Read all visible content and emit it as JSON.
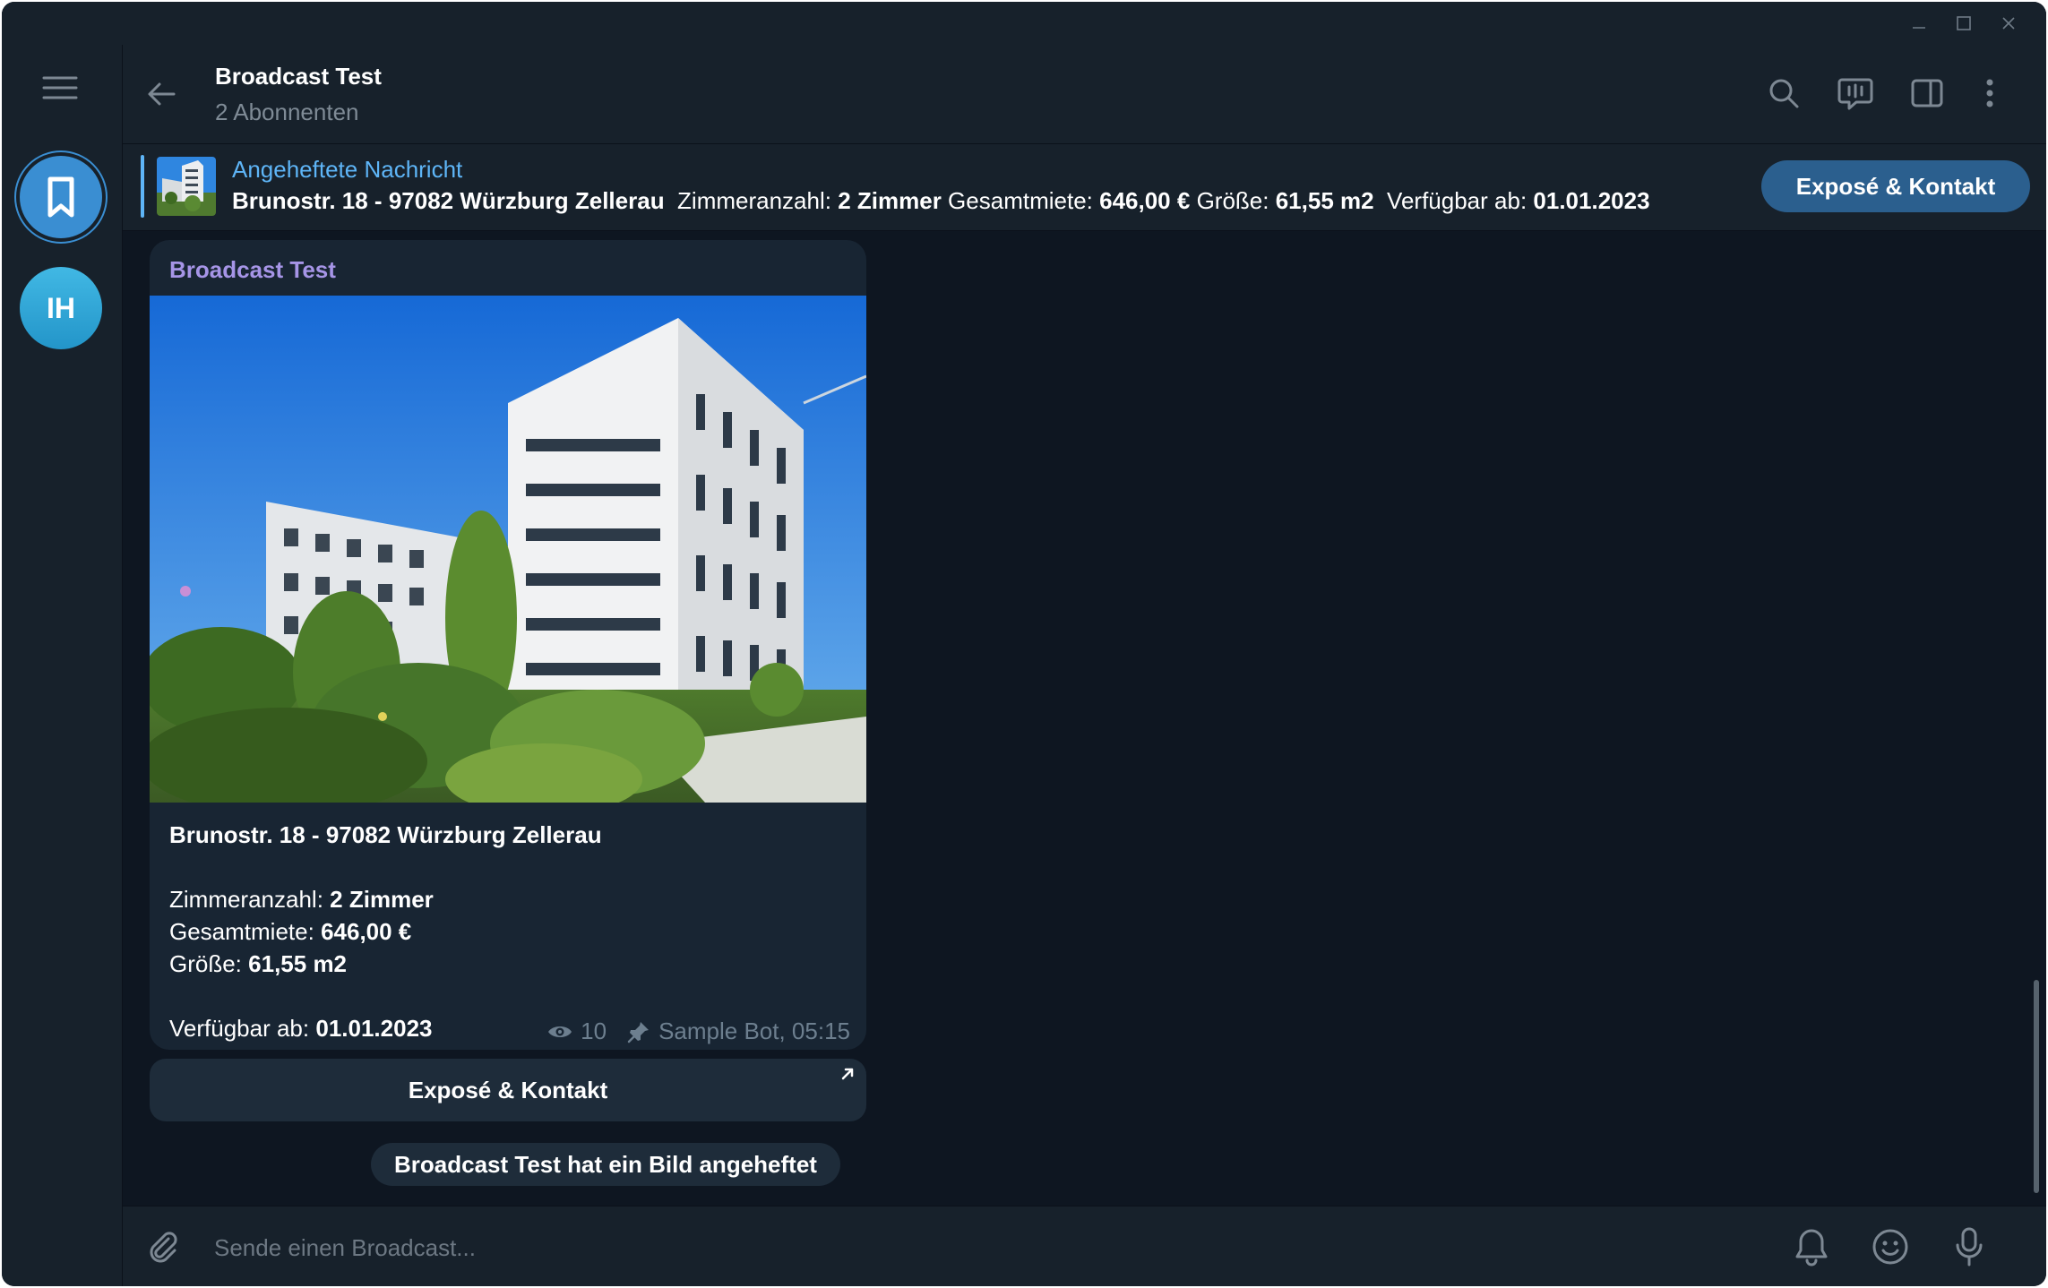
{
  "window": {
    "controls": {
      "minimize": "minimize-icon",
      "maximize": "maximize-icon",
      "close": "close-icon"
    }
  },
  "rail": {
    "menu_icon": "hamburger-menu-icon",
    "saved_icon": "bookmark-icon",
    "saved_color": "#3a8ed2",
    "user_initials": "IH",
    "user_color": "#2aa4d5"
  },
  "header": {
    "back_icon": "back-arrow-icon",
    "title": "Broadcast Test",
    "subtitle": "2 Abonnenten",
    "icons": [
      "search-icon",
      "live-stream-icon",
      "sidebar-toggle-icon",
      "more-vertical-icon"
    ]
  },
  "pinned": {
    "title": "Angeheftete Nachricht",
    "address": "Brunostr. 18 - 97082 Würzburg Zellerau",
    "rooms_label": "Zimmeranzahl:",
    "rooms_value": "2 Zimmer",
    "rent_label": "Gesamtmiete:",
    "rent_value": "646,00 €",
    "size_label": "Größe:",
    "size_value": "61,55 m2",
    "available_label": "Verfügbar ab:",
    "available_value": "01.01.2023",
    "button_label": "Exposé & Kontakt",
    "accent_color": "#5eb5f7"
  },
  "message": {
    "sender": "Broadcast Test",
    "sender_color": "#a695e7",
    "address": "Brunostr. 18 - 97082 Würzburg Zellerau",
    "rooms_label": "Zimmeranzahl:",
    "rooms_value": "2 Zimmer",
    "rent_label": "Gesamtmiete:",
    "rent_value": "646,00 €",
    "size_label": "Größe:",
    "size_value": "61,55 m2",
    "available_label": "Verfügbar ab:",
    "available_value": "01.01.2023",
    "views": "10",
    "signature": "Sample Bot, 05:15",
    "inline_button": "Exposé & Kontakt"
  },
  "service_message": "Broadcast Test hat ein Bild angeheftet",
  "composer": {
    "placeholder": "Sende einen Broadcast...",
    "icons": [
      "paperclip-icon",
      "bell-icon",
      "emoji-icon",
      "microphone-icon"
    ]
  }
}
